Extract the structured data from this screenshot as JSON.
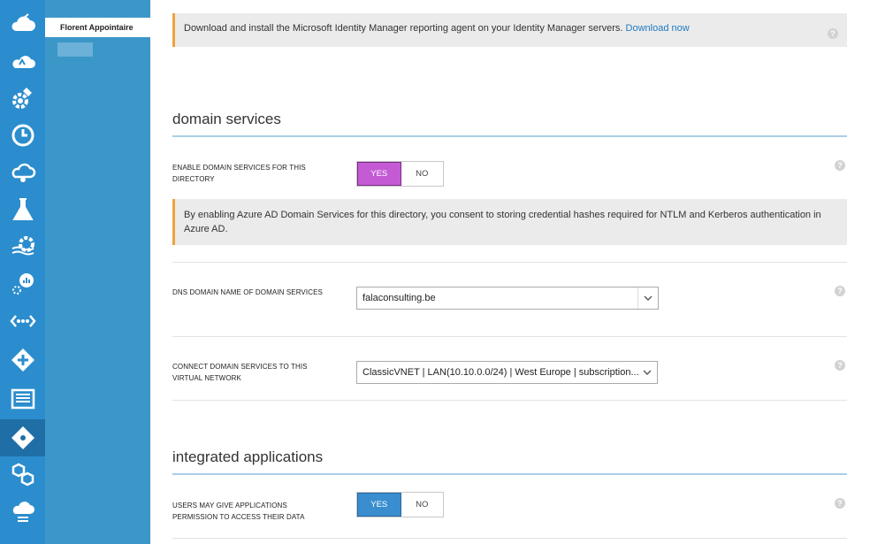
{
  "rail": {
    "items": [
      {
        "name": "cloud-services-icon"
      },
      {
        "name": "cloud-icon"
      },
      {
        "name": "settings-gear-icon"
      },
      {
        "name": "clock-icon"
      },
      {
        "name": "cloud-sync-icon"
      },
      {
        "name": "flask-icon"
      },
      {
        "name": "stream-gear-icon"
      },
      {
        "name": "analytics-icon"
      },
      {
        "name": "connection-dots-icon"
      },
      {
        "name": "arrows-icon"
      },
      {
        "name": "grid-panel-icon"
      },
      {
        "name": "active-directory-icon"
      },
      {
        "name": "hexagon-cluster-icon"
      },
      {
        "name": "cloud-storage-icon"
      }
    ]
  },
  "subnav": {
    "selected_label": "Florent Appointaire"
  },
  "banner_top": {
    "text": "Download and install the Microsoft Identity Manager reporting agent on your Identity Manager servers. ",
    "link": "Download now"
  },
  "domain_services": {
    "title": "domain services",
    "enable_label": "ENABLE DOMAIN SERVICES FOR THIS DIRECTORY",
    "toggle_yes": "YES",
    "toggle_no": "NO",
    "consent_text": "By enabling Azure AD Domain Services for this directory, you consent to storing credential hashes required for NTLM and Kerberos authentication in Azure AD.",
    "dns_label": "DNS DOMAIN NAME OF DOMAIN SERVICES",
    "dns_value": "falaconsulting.be",
    "vnet_label": "CONNECT DOMAIN SERVICES TO THIS VIRTUAL NETWORK",
    "vnet_value": "ClassicVNET | LAN(10.10.0.0/24) | West Europe | subscription..."
  },
  "integrated_apps": {
    "title": "integrated applications",
    "permission_label": "USERS MAY GIVE APPLICATIONS PERMISSION TO ACCESS THEIR DATA",
    "toggle_yes": "YES",
    "toggle_no": "NO"
  },
  "help_glyph": "?",
  "chevron_glyph": "⌄",
  "colors": {
    "rail_bg": "#2b8dcd",
    "subnav_bg": "#3c97c9",
    "toggle_yes_purple": "#c45ad4",
    "toggle_yes_blue": "#3a8ecf",
    "banner_accent": "#f0a23c",
    "link": "#1f7ac2"
  }
}
